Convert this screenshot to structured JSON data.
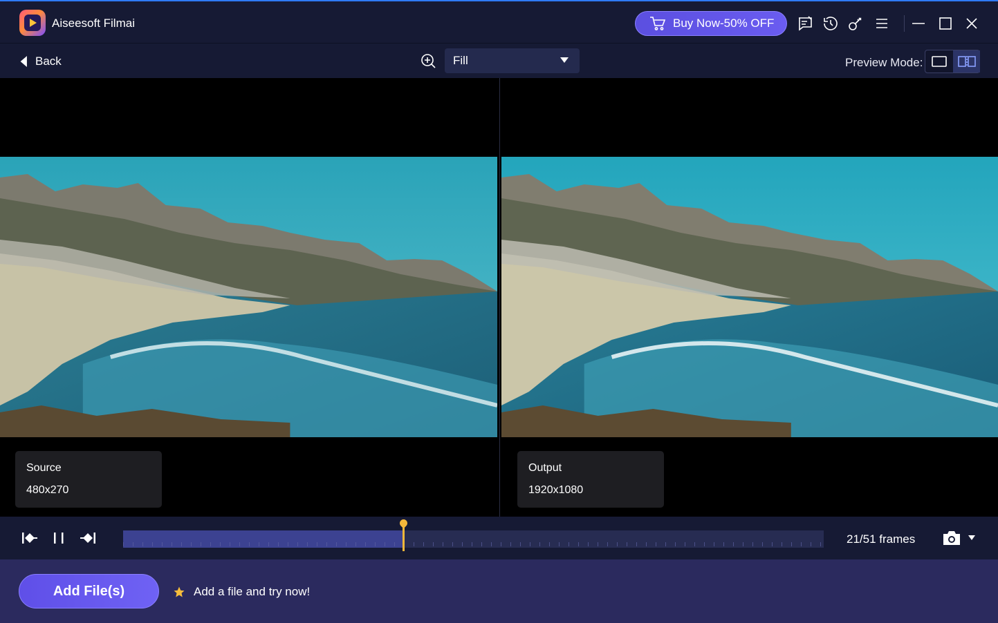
{
  "app": {
    "title": "Aiseesoft Filmai"
  },
  "header": {
    "buy_label": "Buy Now-50% OFF",
    "icons": [
      "feedback-icon",
      "history-icon",
      "key-icon",
      "menu-icon",
      "minimize-icon",
      "maximize-icon",
      "close-icon"
    ]
  },
  "toolbar": {
    "back_label": "Back",
    "fit_mode": "Fill",
    "preview_mode_label": "Preview Mode:",
    "preview_mode_selected": "split"
  },
  "source": {
    "label": "Source",
    "resolution": "480x270"
  },
  "output": {
    "label": "Output",
    "resolution": "1920x1080"
  },
  "player": {
    "frames_text": "21/51 frames",
    "current_frame": 21,
    "total_frames": 51
  },
  "bottom": {
    "add_files_label": "Add File(s)",
    "hint_text": "Add a file and try now!"
  },
  "colors": {
    "accent": "#6a5cf0",
    "playhead": "#f4b73a",
    "background": "#161a34"
  }
}
